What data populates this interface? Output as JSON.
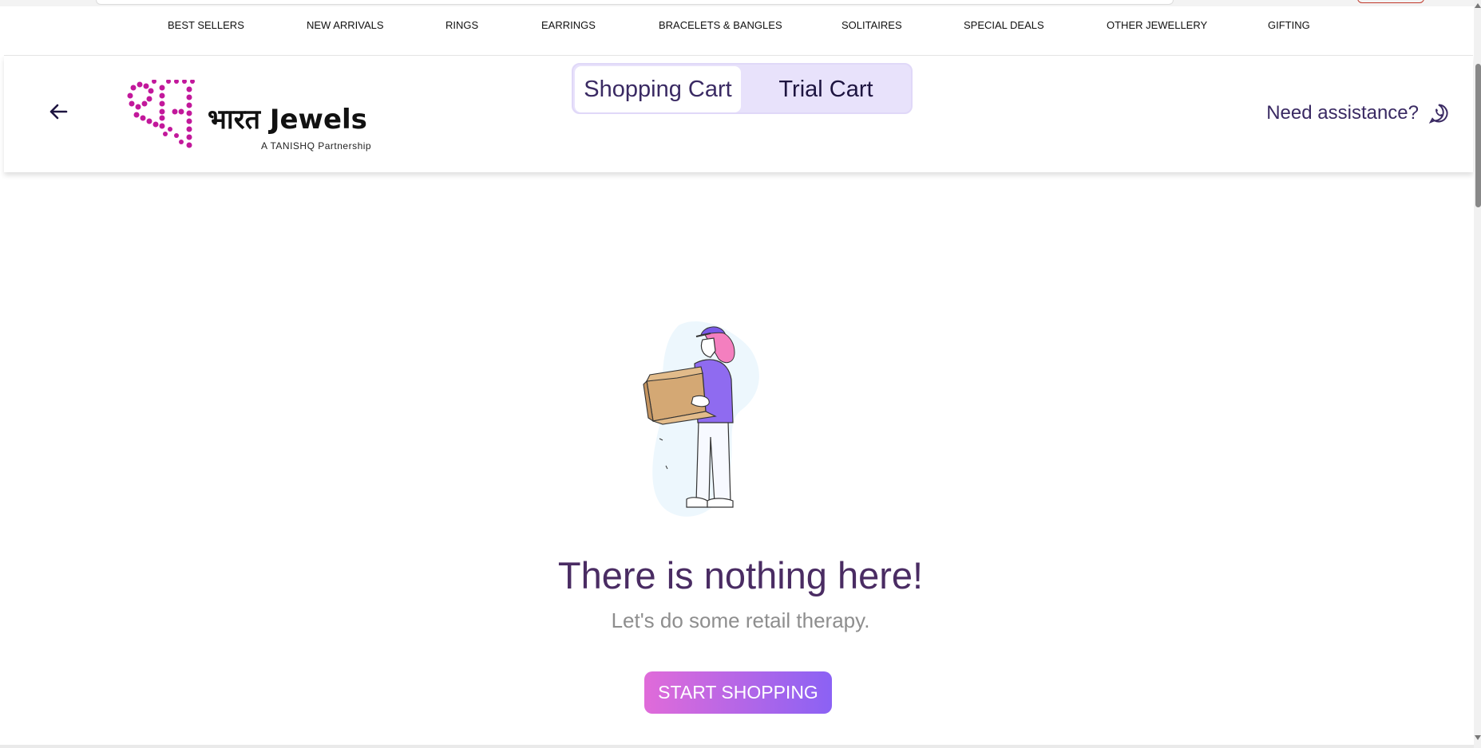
{
  "nav": {
    "items": [
      {
        "label": "BEST SELLERS"
      },
      {
        "label": "NEW ARRIVALS"
      },
      {
        "label": "RINGS"
      },
      {
        "label": "EARRINGS"
      },
      {
        "label": "BRACELETS & BANGLES"
      },
      {
        "label": "SOLITAIRES"
      },
      {
        "label": "SPECIAL DEALS"
      },
      {
        "label": "OTHER JEWELLERY"
      },
      {
        "label": "GIFTING"
      }
    ]
  },
  "header": {
    "back_icon": "arrow-left-icon",
    "logo": {
      "title": "भारत Jewels",
      "subtitle": "A TANISHQ Partnership",
      "brand_color": "#c2189b"
    },
    "cart_tabs": [
      {
        "label": "Shopping Cart",
        "active": true
      },
      {
        "label": "Trial Cart",
        "active": false
      }
    ],
    "assistance": {
      "label": "Need assistance?",
      "icon": "whatsapp-icon"
    }
  },
  "empty_state": {
    "title": "There is nothing here!",
    "subtitle": "Let's do some retail therapy.",
    "button_label": "START SHOPPING",
    "illustration": "person-holding-box-illustration"
  },
  "colors": {
    "accent_purple": "#4a2c63",
    "toggle_bg": "#e8e2fb",
    "button_gradient_start": "#e06bd9",
    "button_gradient_end": "#8b62f4"
  }
}
